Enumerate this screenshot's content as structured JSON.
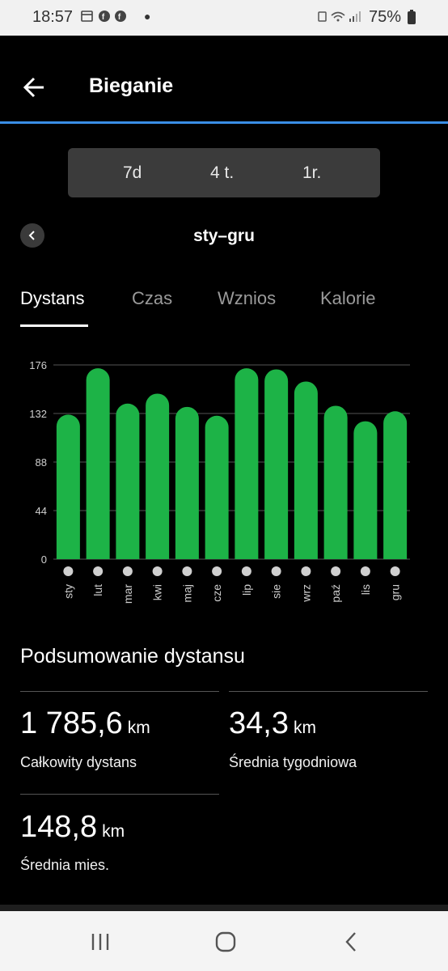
{
  "status_bar": {
    "time": "18:57",
    "battery": "75%",
    "icons": [
      "calendar-icon",
      "facebook-icon",
      "facebook-icon",
      "dot-icon"
    ]
  },
  "app_bar": {
    "title": "Bieganie",
    "back_icon": "arrow-left-icon"
  },
  "period_selector": {
    "options": [
      "7d",
      "4 t.",
      "1r."
    ],
    "selected": "1r."
  },
  "range": {
    "label": "sty–gru"
  },
  "tabs": [
    {
      "label": "Dystans",
      "active": true
    },
    {
      "label": "Czas",
      "active": false
    },
    {
      "label": "Wznios",
      "active": false
    },
    {
      "label": "Kalorie",
      "active": false
    }
  ],
  "chart_data": {
    "type": "bar",
    "categories": [
      "sty",
      "lut",
      "mar",
      "kwi",
      "maj",
      "cze",
      "lip",
      "sie",
      "wrz",
      "paź",
      "lis",
      "gru"
    ],
    "values": [
      131,
      173,
      141,
      150,
      138,
      130,
      173,
      172,
      161,
      139,
      125,
      134
    ],
    "ylim": [
      0,
      176
    ],
    "yticks": [
      0,
      44,
      88,
      132,
      176
    ],
    "grid": true,
    "bar_color": "#1db347",
    "title": "",
    "xlabel": "",
    "ylabel": ""
  },
  "summary": {
    "title": "Podsumowanie dystansu",
    "stats": [
      {
        "value": "1 785,6",
        "unit": "km",
        "label": "Całkowity dystans"
      },
      {
        "value": "34,3",
        "unit": "km",
        "label": "Średnia tygodniowa"
      },
      {
        "value": "148,8",
        "unit": "km",
        "label": "Średnia mies."
      }
    ]
  },
  "nav_bar": {
    "icons": [
      "recent-apps-icon",
      "home-icon",
      "back-icon"
    ]
  },
  "colors": {
    "accent": "#3a8ee6",
    "bar": "#1db347",
    "background": "#000000"
  }
}
